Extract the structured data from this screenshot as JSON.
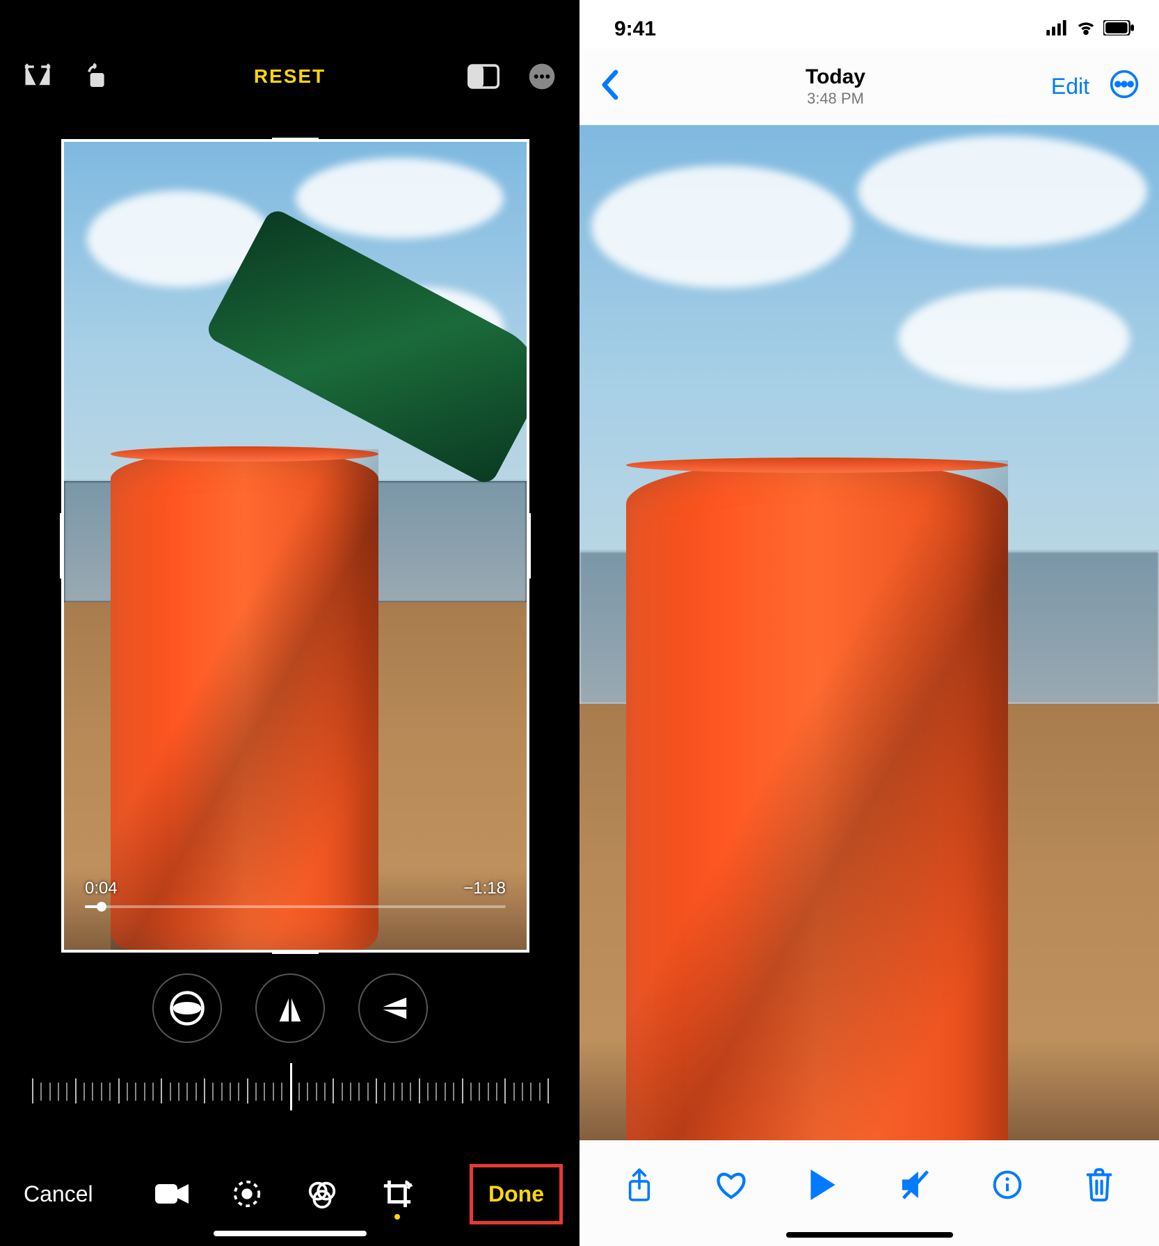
{
  "editor": {
    "topbar": {
      "flip_icon": "flip-horizontal-icon",
      "rotate_icon": "rotate-icon",
      "reset_label": "RESET",
      "aspect_icon": "aspect-ratio-icon",
      "more_icon": "more-icon"
    },
    "video": {
      "elapsed": "0:04",
      "remaining": "−1:18"
    },
    "circle_tools": {
      "straighten": "straighten-icon",
      "vertical_perspective": "vertical-perspective-icon",
      "horizontal_perspective": "horizontal-perspective-icon"
    },
    "bottombar": {
      "cancel_label": "Cancel",
      "done_label": "Done",
      "tools": {
        "video": "video-icon",
        "adjust": "adjust-icon",
        "filters": "filters-icon",
        "crop": "crop-icon"
      }
    }
  },
  "viewer": {
    "status": {
      "time": "9:41"
    },
    "topbar": {
      "title": "Today",
      "subtitle": "3:48 PM",
      "edit_label": "Edit"
    },
    "bottombar": {
      "share": "share-icon",
      "favorite": "heart-icon",
      "play": "play-icon",
      "mute": "mute-icon",
      "info": "info-icon",
      "trash": "trash-icon"
    }
  },
  "colors": {
    "ios_blue": "#007aff",
    "ios_yellow": "#ffd60a",
    "highlight_box": "#e53935"
  }
}
